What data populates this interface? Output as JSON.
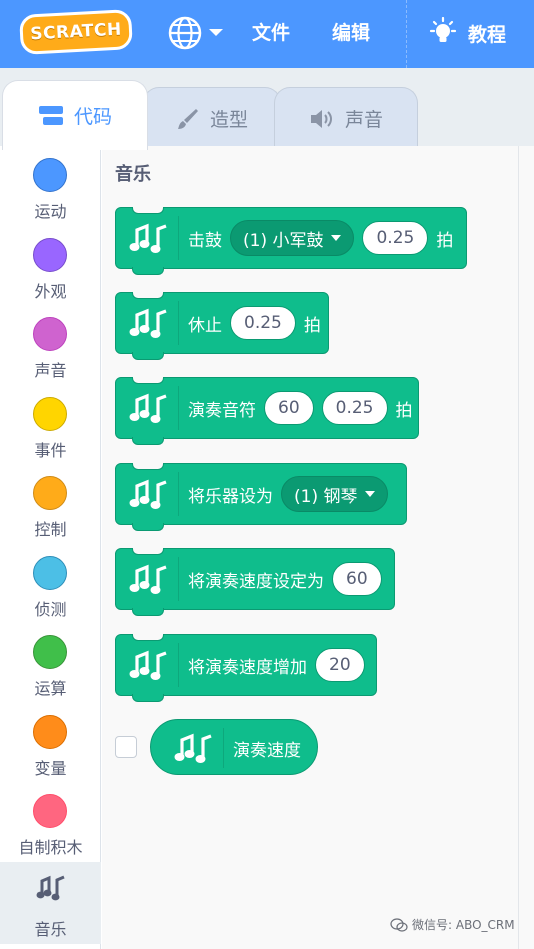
{
  "menubar": {
    "logo": "SCRATCH",
    "file": "文件",
    "edit": "编辑",
    "tutorials": "教程"
  },
  "tabs": [
    {
      "label": "代码",
      "icon": "code-icon",
      "active": true
    },
    {
      "label": "造型",
      "icon": "brush-icon",
      "active": false
    },
    {
      "label": "声音",
      "icon": "speaker-icon",
      "active": false
    }
  ],
  "categories": [
    {
      "label": "运动",
      "color": "#4c97ff"
    },
    {
      "label": "外观",
      "color": "#9966ff"
    },
    {
      "label": "声音",
      "color": "#cf63cf"
    },
    {
      "label": "事件",
      "color": "#ffd500"
    },
    {
      "label": "控制",
      "color": "#ffab19"
    },
    {
      "label": "侦测",
      "color": "#4cbfe6"
    },
    {
      "label": "运算",
      "color": "#40bf4a"
    },
    {
      "label": "变量",
      "color": "#ff8c1a"
    },
    {
      "label": "自制积木",
      "color": "#ff6680"
    },
    {
      "label": "音乐",
      "icon": "music-icon"
    }
  ],
  "palette": {
    "section_title": "音乐",
    "blocks": {
      "drum": {
        "text": "击鼓",
        "dropdown": "(1) 小军鼓",
        "value": "0.25",
        "suffix": "拍"
      },
      "rest": {
        "text": "休止",
        "value": "0.25",
        "suffix": "拍"
      },
      "note": {
        "text": "演奏音符",
        "value1": "60",
        "value2": "0.25",
        "suffix": "拍"
      },
      "instrument": {
        "text": "将乐器设为",
        "dropdown": "(1) 钢琴"
      },
      "set_tempo": {
        "text": "将演奏速度设定为",
        "value": "60"
      },
      "change_tempo": {
        "text": "将演奏速度增加",
        "value": "20"
      },
      "tempo": {
        "text": "演奏速度"
      }
    }
  },
  "watermark": "微信号: ABO_CRM",
  "colors": {
    "menubar": "#4c97ff",
    "music_block": "#0fbd8c",
    "music_block_dark": "#0b9a72"
  }
}
